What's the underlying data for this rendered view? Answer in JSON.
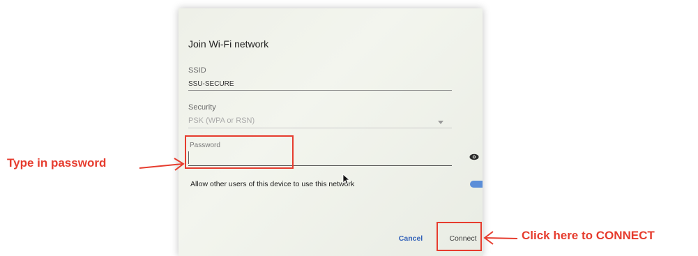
{
  "dialog": {
    "title": "Join Wi-Fi network",
    "ssid": {
      "label": "SSID",
      "value": "SSU-SECURE"
    },
    "security": {
      "label": "Security",
      "value": "PSK (WPA or RSN)",
      "icon": "dropdown-arrow-icon"
    },
    "password": {
      "label": "Password",
      "value": "",
      "visibility_icon": "eye-icon"
    },
    "share_network": {
      "label": "Allow other users of this device to use this network",
      "enabled": true
    },
    "buttons": {
      "cancel": "Cancel",
      "connect": "Connect"
    }
  },
  "annotations": {
    "password_callout": "Type in password",
    "connect_callout": "Click here to CONNECT",
    "color": "#e63c2e"
  },
  "colors": {
    "accent": "#2f5fb8",
    "toggle": "#5b8ed8"
  }
}
